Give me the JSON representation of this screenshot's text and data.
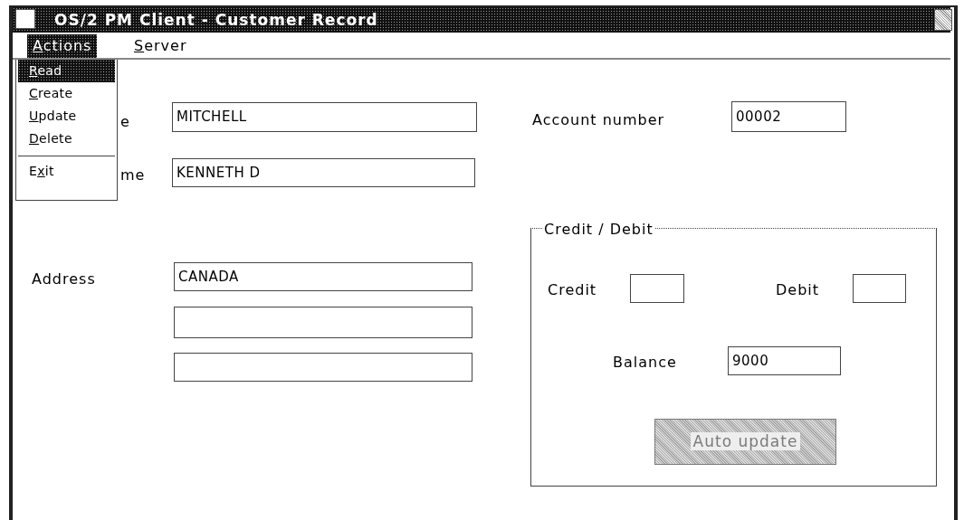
{
  "window": {
    "title": "OS/2 PM Client - Customer Record"
  },
  "menubar": [
    {
      "key": "A",
      "post": "ctions",
      "selected": true
    },
    {
      "key": "S",
      "post": "erver",
      "selected": false
    }
  ],
  "menu": {
    "items": [
      {
        "kind": "item",
        "key": "R",
        "post": "ead",
        "selected": true
      },
      {
        "kind": "item",
        "key": "C",
        "post": "reate",
        "selected": false
      },
      {
        "kind": "item",
        "key": "U",
        "post": "pdate",
        "selected": false
      },
      {
        "kind": "item",
        "key": "D",
        "post": "elete",
        "selected": false
      },
      {
        "kind": "separator"
      },
      {
        "kind": "item",
        "pre": "E",
        "key": "x",
        "post": "it",
        "selected": false
      }
    ]
  },
  "fields": [
    {
      "kind": "text_field",
      "label": "e",
      "value": "MITCHELL"
    },
    {
      "kind": "text_field",
      "label": "me",
      "value": "KENNETH D"
    },
    {
      "kind": "text_field",
      "label": "Account number",
      "value": "00002"
    },
    {
      "kind": "text_field",
      "label": "Address",
      "value": "CANADA"
    },
    {
      "kind": "text_field"
    },
    {
      "kind": "text_field"
    }
  ],
  "group": {
    "title": "Credit / Debit",
    "fields": [
      {
        "label": "Credit"
      },
      {
        "label": "Debit"
      },
      {
        "label": "Balance",
        "value": "9000"
      }
    ],
    "button": {
      "label": "Auto update",
      "disabled": true
    }
  }
}
